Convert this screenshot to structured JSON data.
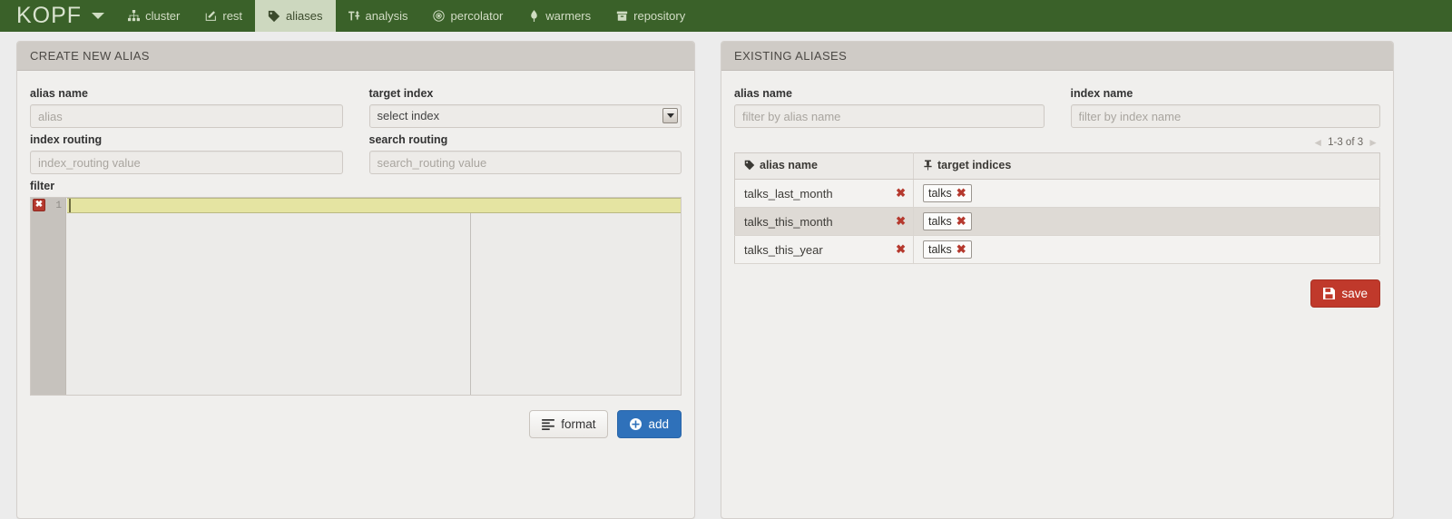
{
  "navbar": {
    "brand": "KOPF",
    "items": [
      {
        "label": "cluster",
        "icon": "sitemap-icon",
        "active": false
      },
      {
        "label": "rest",
        "icon": "pencil-square-icon",
        "active": false
      },
      {
        "label": "aliases",
        "icon": "tag-icon",
        "active": true
      },
      {
        "label": "analysis",
        "icon": "text-height-icon",
        "active": false
      },
      {
        "label": "percolator",
        "icon": "bullseye-icon",
        "active": false
      },
      {
        "label": "warmers",
        "icon": "flame-icon",
        "active": false
      },
      {
        "label": "repository",
        "icon": "archive-icon",
        "active": false
      }
    ]
  },
  "create_panel": {
    "title": "CREATE NEW ALIAS",
    "alias_name_label": "alias name",
    "alias_name_placeholder": "alias",
    "alias_name_value": "",
    "target_index_label": "target index",
    "target_index_selected": "select index",
    "index_routing_label": "index routing",
    "index_routing_placeholder": "index_routing value",
    "index_routing_value": "",
    "search_routing_label": "search routing",
    "search_routing_placeholder": "search_routing value",
    "search_routing_value": "",
    "filter_label": "filter",
    "editor": {
      "line_number": "1",
      "error_marker": "✖",
      "content": ""
    },
    "format_button": "format",
    "add_button": "add"
  },
  "existing_panel": {
    "title": "EXISTING ALIASES",
    "alias_name_label": "alias name",
    "alias_name_placeholder": "filter by alias name",
    "alias_name_value": "",
    "index_name_label": "index name",
    "index_name_placeholder": "filter by index name",
    "index_name_value": "",
    "pagination": {
      "prev": "◄",
      "summary": "1-3 of 3",
      "next": "►"
    },
    "table": {
      "headers": [
        "alias name",
        "target indices"
      ],
      "header_icons": [
        "tag-icon",
        "thumbtack-icon"
      ],
      "rows": [
        {
          "alias": "talks_last_month",
          "delete": "✖",
          "indices": [
            {
              "name": "talks",
              "delete": "✖"
            }
          ]
        },
        {
          "alias": "talks_this_month",
          "delete": "✖",
          "indices": [
            {
              "name": "talks",
              "delete": "✖"
            }
          ]
        },
        {
          "alias": "talks_this_year",
          "delete": "✖",
          "indices": [
            {
              "name": "talks",
              "delete": "✖"
            }
          ]
        }
      ]
    },
    "save_button": "save"
  },
  "colors": {
    "navbar_green": "#3a6129",
    "active_tab": "#cdd8bf",
    "primary_blue": "#2f71ba",
    "danger_red": "#c0392b",
    "error_marker": "#b5392e",
    "editor_active_line": "#e5e4a2",
    "panel_header": "#cfcbc6",
    "body_bg": "#ececec"
  }
}
